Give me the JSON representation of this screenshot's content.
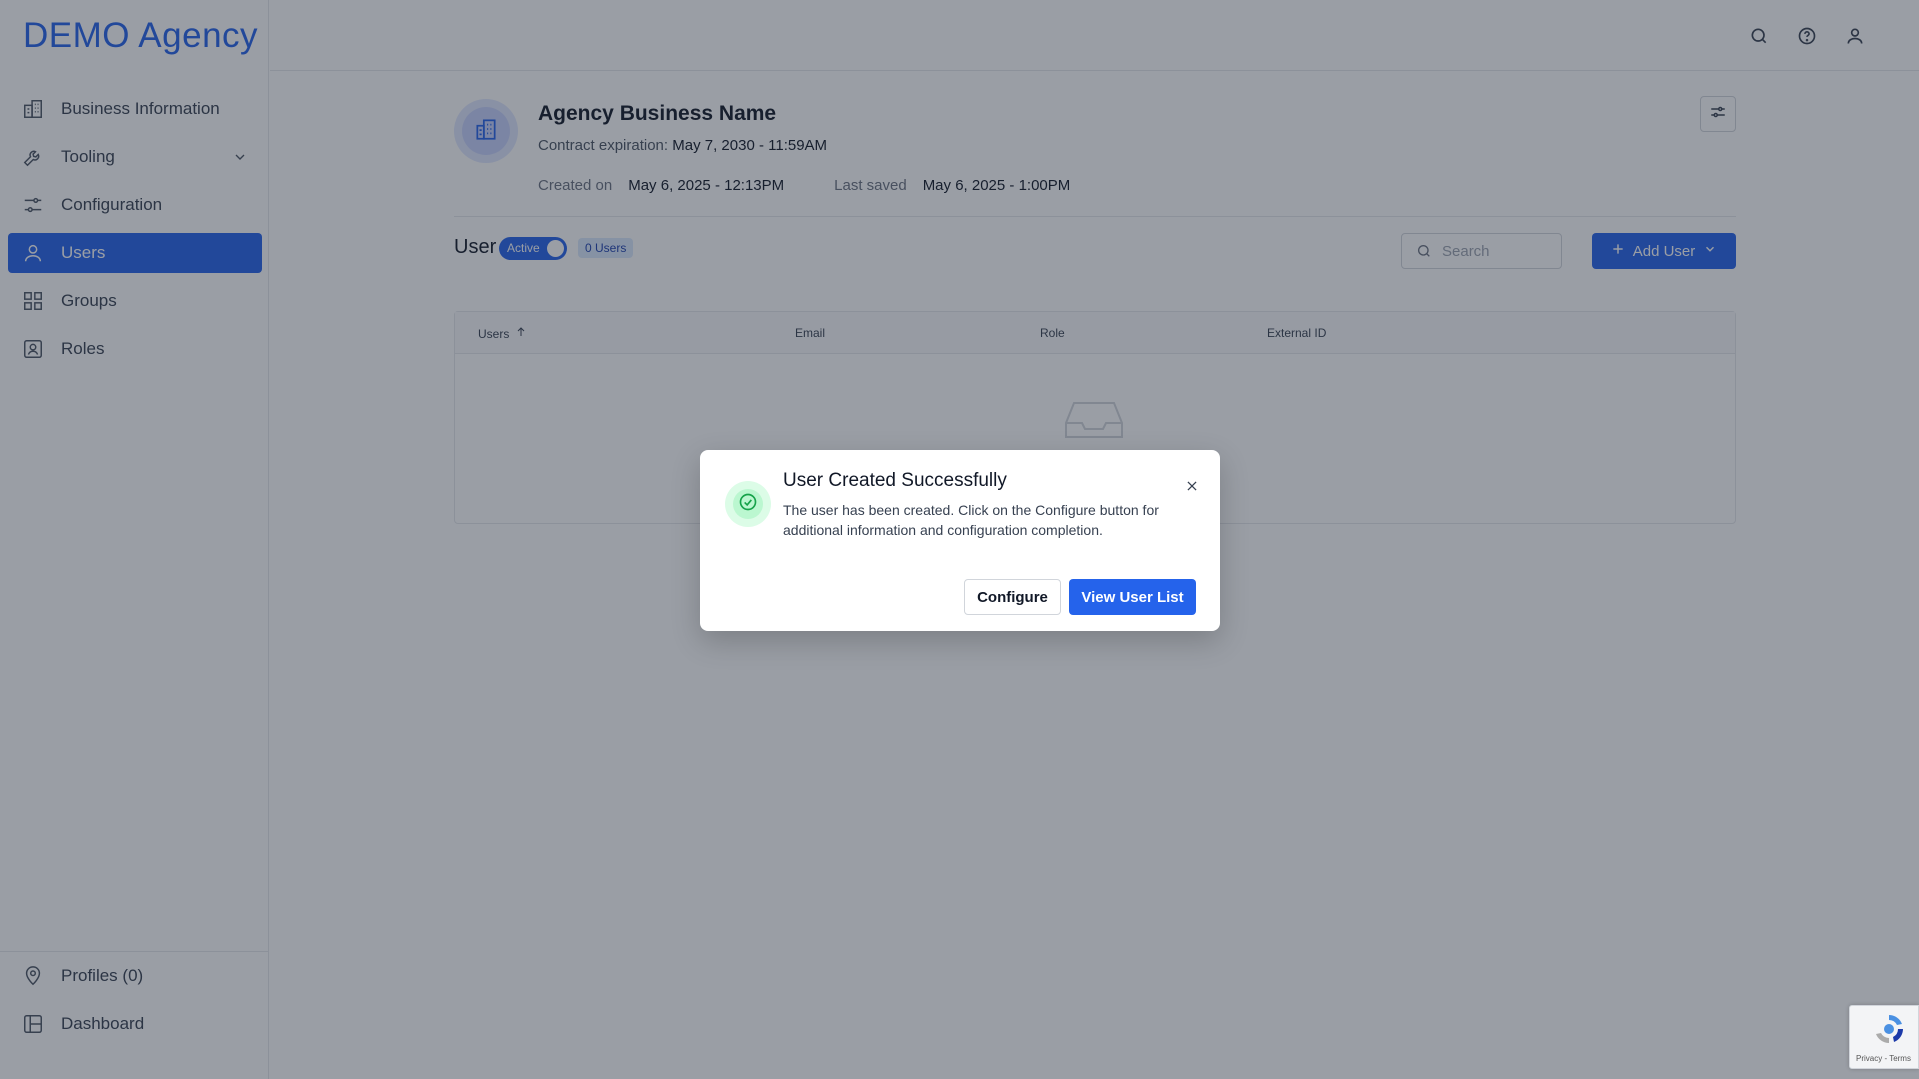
{
  "brand": "DEMO Agency",
  "sidebar": {
    "items": [
      {
        "label": "Business Information",
        "icon": "building-icon"
      },
      {
        "label": "Tooling",
        "icon": "wrench-icon"
      },
      {
        "label": "Configuration",
        "icon": "sliders-icon"
      },
      {
        "label": "Users",
        "icon": "user-icon",
        "active": true
      },
      {
        "label": "Groups",
        "icon": "grid-icon"
      },
      {
        "label": "Roles",
        "icon": "id-card-icon"
      }
    ],
    "bottom_items": [
      {
        "label": "Profiles (0)",
        "icon": "map-pin-icon"
      },
      {
        "label": "Dashboard",
        "icon": "layout-icon"
      }
    ]
  },
  "header": {
    "title": "Agency Business Name",
    "contract_label": "Contract expiration:",
    "contract_value": "May 7, 2030 - 11:59AM",
    "created_label": "Created on",
    "created_value": "May 6, 2025 - 12:13PM",
    "saved_label": "Last saved",
    "saved_value": "May 6, 2025 - 1:00PM"
  },
  "users_section": {
    "title": "User",
    "toggle_label": "Active",
    "count_badge": "0 Users",
    "search_placeholder": "Search",
    "add_user_label": "Add User"
  },
  "table": {
    "columns": [
      "Users",
      "Email",
      "Role",
      "External ID"
    ]
  },
  "modal": {
    "title": "User Created Successfully",
    "text": "The user has been created. Click on the Configure button for additional information and configuration completion.",
    "configure_label": "Configure",
    "view_label": "View User List"
  },
  "recaptcha": {
    "legal": "Privacy - Terms"
  },
  "colors": {
    "accent": "#2563eb",
    "success": "#16a34a",
    "overlay": "rgba(31,41,55,0.45)"
  }
}
